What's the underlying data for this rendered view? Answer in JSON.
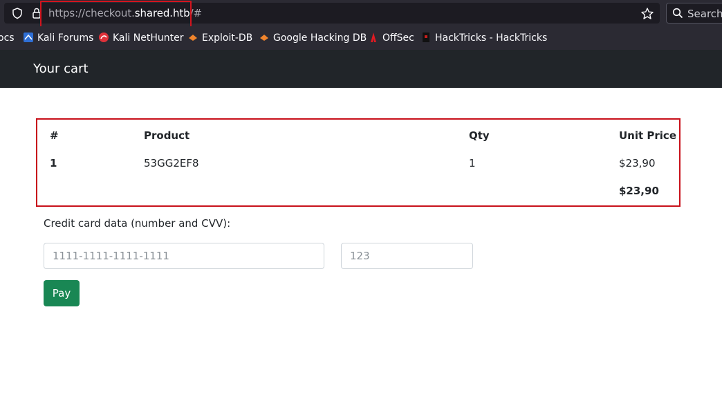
{
  "browser": {
    "url_scheme": "https://checkout.",
    "url_host": "shared.htb",
    "url_path": "/#",
    "search_label": "Search"
  },
  "bookmarks": [
    {
      "label": "ocs",
      "icon": "none"
    },
    {
      "label": "Kali Forums",
      "icon": "kali-forums-icon"
    },
    {
      "label": "Kali NetHunter",
      "icon": "kali-nethunter-icon"
    },
    {
      "label": "Exploit-DB",
      "icon": "exploit-db-icon"
    },
    {
      "label": "Google Hacking DB",
      "icon": "ghdb-icon"
    },
    {
      "label": "OffSec",
      "icon": "offsec-icon"
    },
    {
      "label": "HackTricks - HackTricks",
      "icon": "hacktricks-icon"
    }
  ],
  "navbar": {
    "brand": "Your cart"
  },
  "cart": {
    "headers": {
      "num": "#",
      "product": "Product",
      "qty": "Qty",
      "unit_price": "Unit Price"
    },
    "rows": [
      {
        "num": "1",
        "product": "53GG2EF8",
        "qty": "1",
        "unit_price": "$23,90"
      }
    ],
    "total": "$23,90"
  },
  "payment": {
    "label": "Credit card data (number and CVV):",
    "card_placeholder": "1111-1111-1111-1111",
    "cvv_placeholder": "123",
    "pay_label": "Pay"
  },
  "colors": {
    "highlight": "#d2141e",
    "navbar": "#212529",
    "pay_button": "#198754"
  }
}
